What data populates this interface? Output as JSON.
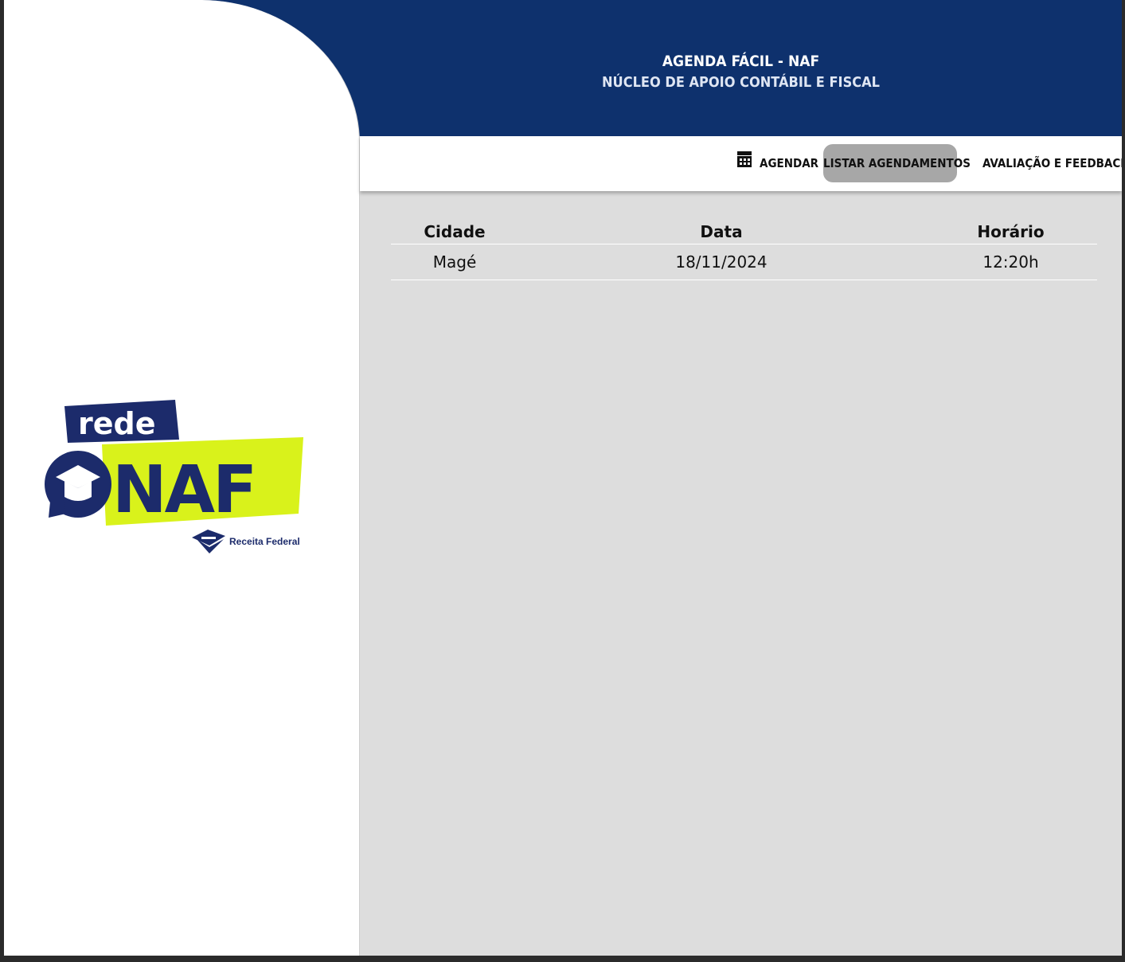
{
  "header": {
    "title": "AGENDA FÁCIL - NAF",
    "subtitle": "NÚCLEO DE APOIO CONTÁBIL E FISCAL"
  },
  "nav": {
    "agendar": {
      "label": "AGENDAR",
      "icon": "calendar-icon"
    },
    "listar": {
      "label": "LISTAR AGENDAMENTOS",
      "active": true
    },
    "feedback": {
      "label": "AVALIAÇÃO E FEEDBACK"
    }
  },
  "logo": {
    "rede": "rede",
    "naf": "NAF",
    "org": "Receita Federal"
  },
  "table": {
    "headers": [
      "Cidade",
      "Data",
      "Horário"
    ],
    "rows": [
      [
        "Magé",
        "18/11/2024",
        "12:20h"
      ]
    ]
  },
  "colors": {
    "header_bg": "#0e316d",
    "content_bg": "#dddddd",
    "active_tab_bg": "#a7a7a7",
    "logo_lime": "#d9f21b",
    "logo_navy": "#1c2b6b"
  }
}
